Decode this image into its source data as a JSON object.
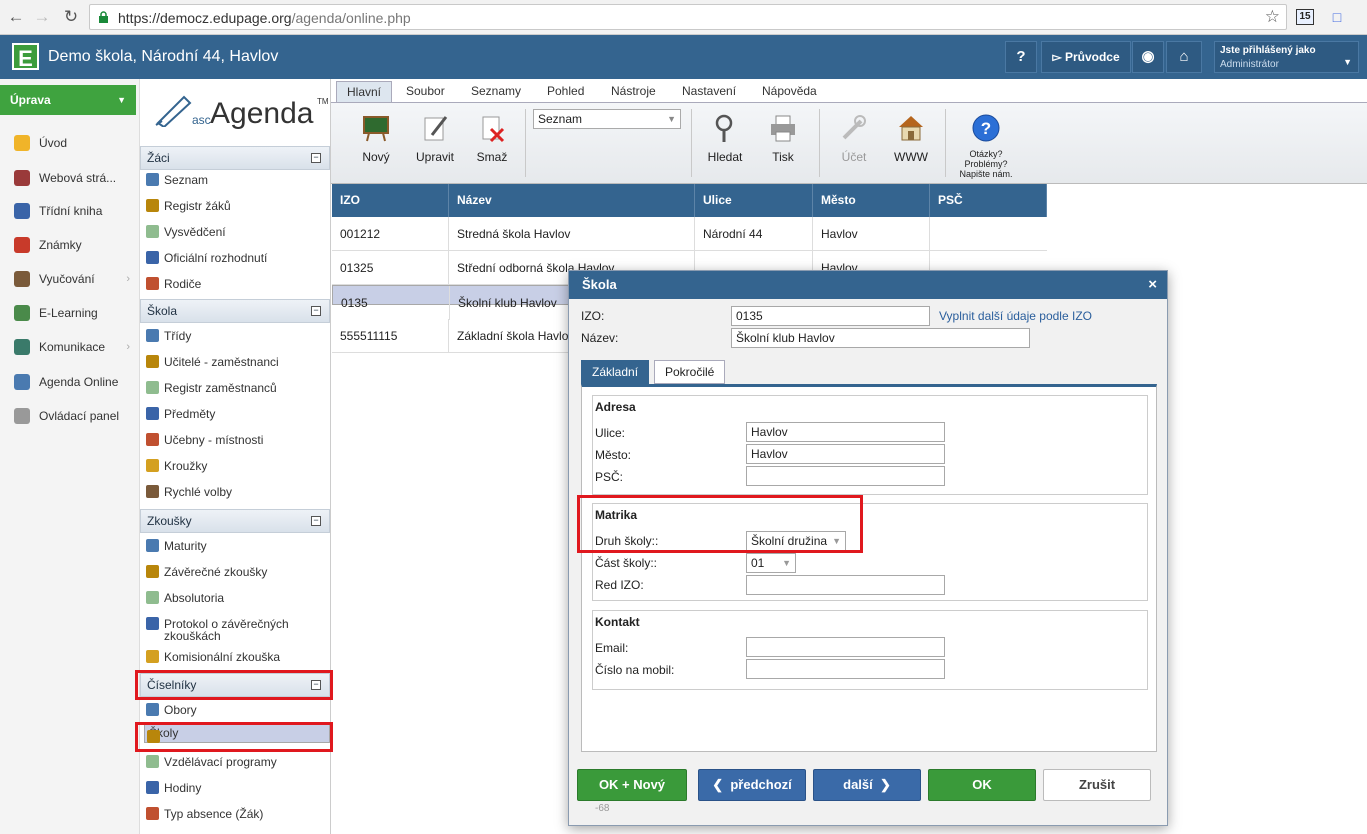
{
  "browser": {
    "url_host": "https://democz.edupage.org",
    "url_path": "/agenda/online.php",
    "ext_badge": "15"
  },
  "header": {
    "logo_letter": "E",
    "title": "Demo škola, Národní 44, Havlov",
    "help_label": "?",
    "guide_label": "Průvodce",
    "user_label": "Jste přihlášený jako",
    "user_role": "Administrátor"
  },
  "leftnav": {
    "uprava": "Úprava",
    "items": [
      {
        "label": "Úvod",
        "color": "#f0b429"
      },
      {
        "label": "Webová strá...",
        "color": "#9a3a3a"
      },
      {
        "label": "Třídní kniha",
        "color": "#3a64a8"
      },
      {
        "label": "Známky",
        "color": "#c83a2a"
      },
      {
        "label": "Vyučování",
        "color": "#7a5a3a"
      },
      {
        "label": "E-Learning",
        "color": "#4a8a4a"
      },
      {
        "label": "Komunikace",
        "color": "#3a7a6a"
      },
      {
        "label": "Agenda Online",
        "color": "#4a7ab0"
      },
      {
        "label": "Ovládací panel",
        "color": "#999999"
      }
    ]
  },
  "modules": {
    "logo_small": "asc",
    "logo_big": "Agenda",
    "logo_tm": "TM",
    "sections": {
      "zaci": "Žáci",
      "skola": "Škola",
      "zkousky": "Zkoušky",
      "ciselniky": "Číselníky"
    },
    "zaci_items": [
      "Seznam",
      "Registr žáků",
      "Vysvědčení",
      "Oficiální rozhodnutí",
      "Rodiče"
    ],
    "skola_items": [
      "Třídy",
      "Učitelé - zaměstnanci",
      "Registr zaměstnanců",
      "Předměty",
      "Učebny - místnosti",
      "Kroužky",
      "Rychlé volby"
    ],
    "zkousky_items": [
      "Maturity",
      "Závěrečné zkoušky",
      "Absolutoria",
      "Protokol o závěrečných",
      "zkouškách",
      "Komisionální zkouška"
    ],
    "ciselniky_items": [
      "Obory",
      "Školy",
      "Vzdělávací programy",
      "Hodiny",
      "Typ absence (Žák)"
    ]
  },
  "tabs": [
    "Hlavní",
    "Soubor",
    "Seznamy",
    "Pohled",
    "Nástroje",
    "Nastavení",
    "Nápověda"
  ],
  "toolbar": {
    "new": "Nový",
    "edit": "Upravit",
    "delete": "Smaž",
    "list_select": "Seznam",
    "search": "Hledat",
    "print": "Tisk",
    "account": "Účet",
    "www": "WWW",
    "help_line1": "Otázky?",
    "help_line2": "Problémy?",
    "help_line3": "Napište nám."
  },
  "grid": {
    "columns": [
      "IZO",
      "Název",
      "Ulice",
      "Město",
      "PSČ"
    ],
    "rows": [
      [
        "001212",
        "Stredná škola Havlov",
        "Národní 44",
        "Havlov",
        ""
      ],
      [
        "01325",
        "Střední odborná škola Havlov",
        "",
        "Havlov",
        ""
      ],
      [
        "0135",
        "Školní klub Havlov",
        "",
        "",
        ""
      ],
      [
        "555511115",
        "Základní škola Havlov",
        "",
        "",
        ""
      ]
    ]
  },
  "dialog": {
    "title": "Škola",
    "close": "×",
    "izo_label": "IZO:",
    "izo_value": "0135",
    "izo_link": "Vyplnit další údaje podle IZO",
    "name_label": "Název:",
    "name_value": "Školní klub Havlov",
    "tab_basic": "Základní",
    "tab_advanced": "Pokročilé",
    "address": {
      "legend": "Adresa",
      "street_label": "Ulice:",
      "street_value": "Havlov",
      "city_label": "Město:",
      "city_value": "Havlov",
      "zip_label": "PSČ:",
      "zip_value": ""
    },
    "matrika": {
      "legend": "Matrika",
      "type_label": "Druh školy::",
      "type_value": "Školní družina",
      "part_label": "Část školy::",
      "part_value": "01",
      "red_izo_label": "Red IZO:",
      "red_izo_value": ""
    },
    "contact": {
      "legend": "Kontakt",
      "email_label": "Email:",
      "email_value": "",
      "mobile_label": "Číslo na mobil:",
      "mobile_value": ""
    },
    "buttons": {
      "ok_new": "OK + Nový",
      "prev": "předchozí",
      "next": "další",
      "ok": "OK",
      "cancel": "Zrušit"
    },
    "footer_text": "-68"
  }
}
